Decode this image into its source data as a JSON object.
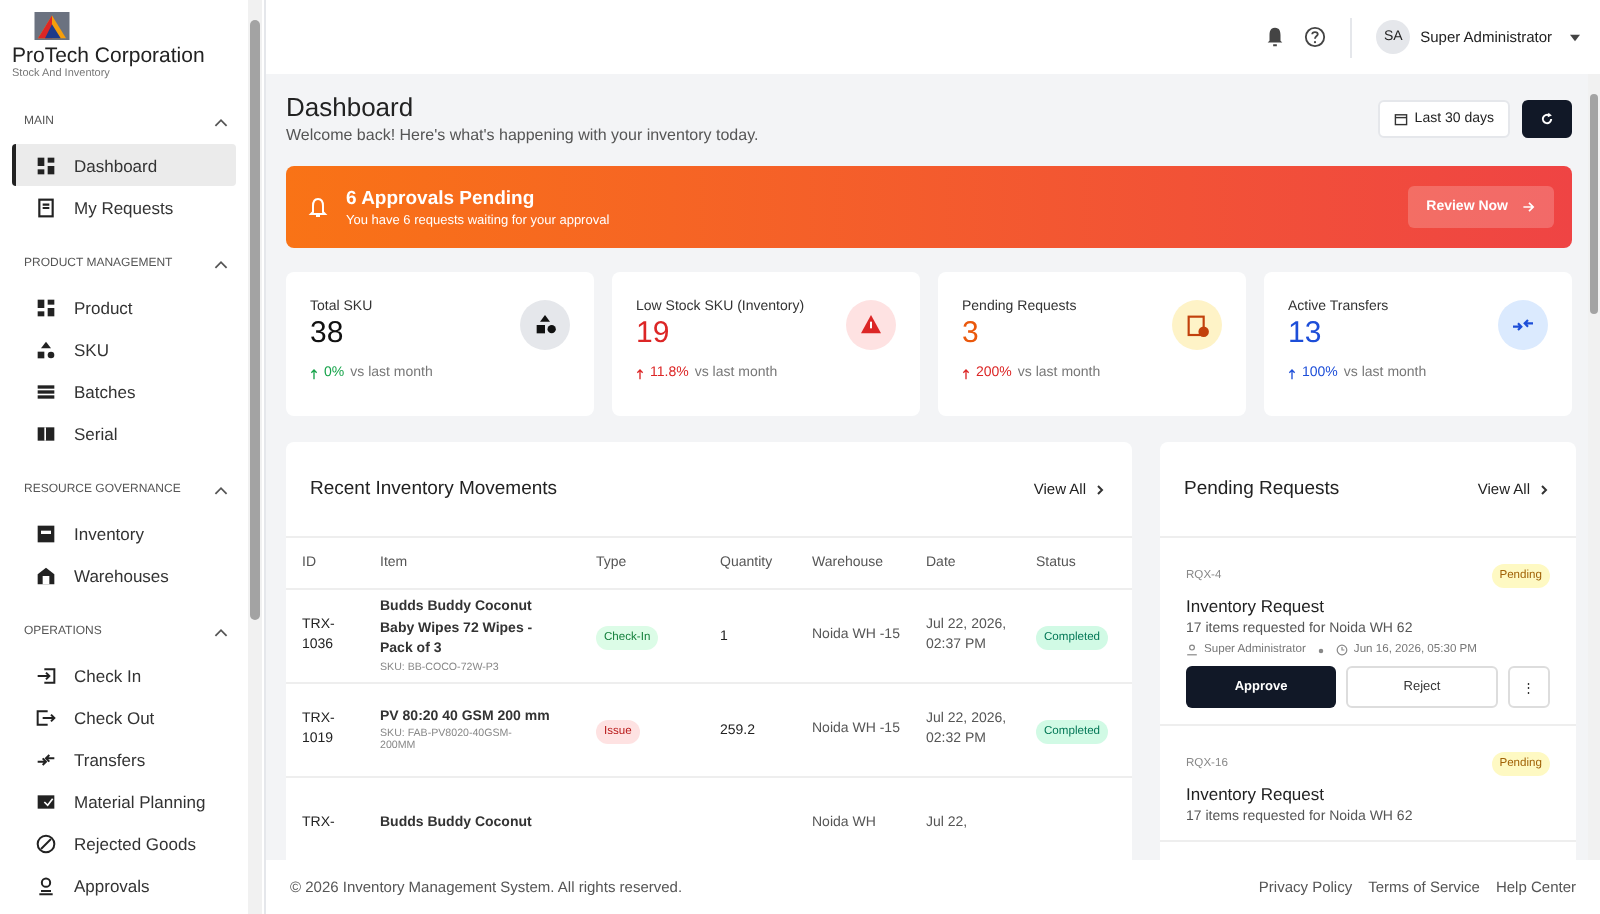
{
  "sidebar": {
    "brand": "ProTech Corporation",
    "subtitle": "Stock And Inventory",
    "sections": [
      {
        "title": "MAIN",
        "expanded": true,
        "items": [
          {
            "label": "Dashboard",
            "selected": true
          },
          {
            "label": "My Requests",
            "selected": false
          }
        ]
      },
      {
        "title": "PRODUCT MANAGEMENT",
        "expanded": true,
        "items": [
          {
            "label": "Product",
            "selected": false
          },
          {
            "label": "SKU",
            "selected": false
          },
          {
            "label": "Batches",
            "selected": false
          },
          {
            "label": "Serial",
            "selected": false
          }
        ]
      },
      {
        "title": "RESOURCE GOVERNANCE",
        "expanded": true,
        "items": [
          {
            "label": "Inventory",
            "selected": false
          },
          {
            "label": "Warehouses",
            "selected": false
          }
        ]
      },
      {
        "title": "OPERATIONS",
        "expanded": true,
        "items": [
          {
            "label": "Check In",
            "selected": false
          },
          {
            "label": "Check Out",
            "selected": false
          },
          {
            "label": "Transfers",
            "selected": false
          },
          {
            "label": "Material Planning",
            "selected": false
          },
          {
            "label": "Rejected Goods",
            "selected": false
          },
          {
            "label": "Approvals",
            "selected": false
          }
        ]
      }
    ]
  },
  "topbar": {
    "avatar": "SA",
    "user": "Super Administrator"
  },
  "header": {
    "title": "Dashboard",
    "subtitle": "Welcome back! Here's what's happening with your inventory today.",
    "range": "Last 30 days"
  },
  "alert": {
    "title": "6 Approvals Pending",
    "message": "You have 6 requests waiting for your approval",
    "button": "Review Now"
  },
  "stats": [
    {
      "label": "Total SKU",
      "value": "38",
      "change": "0%",
      "suffix": "vs last month",
      "kind": "neutral"
    },
    {
      "label": "Low Stock SKU (Inventory)",
      "value": "19",
      "change": "11.8%",
      "suffix": "vs last month",
      "kind": "danger"
    },
    {
      "label": "Pending Requests",
      "value": "3",
      "change": "200%",
      "suffix": "vs last month",
      "kind": "warning"
    },
    {
      "label": "Active Transfers",
      "value": "13",
      "change": "100%",
      "suffix": "vs last month",
      "kind": "info"
    }
  ],
  "movements": {
    "title": "Recent Inventory Movements",
    "view_all": "View All",
    "columns": [
      "ID",
      "Item",
      "Type",
      "Quantity",
      "Warehouse",
      "Date",
      "Status"
    ],
    "rows": [
      {
        "id": "TRX-1036",
        "item": "Budds Buddy Coconut Baby Wipes 72 Wipes - Pack of 3",
        "sku": "SKU: BB-COCO-72W-P3",
        "type": {
          "label": "Check-In",
          "kind": "in"
        },
        "quantity": "1",
        "warehouse": "Noida WH -15",
        "date": "Jul 22, 2026, 02:37 PM",
        "status": "Completed"
      },
      {
        "id": "TRX-1019",
        "item": "PV 80:20 40 GSM 200 mm",
        "sku": "SKU: FAB-PV8020-40GSM-200MM",
        "type": {
          "label": "Issue",
          "kind": "issue"
        },
        "quantity": "259.2",
        "warehouse": "Noida WH -15",
        "date": "Jul 22, 2026, 02:32 PM",
        "status": "Completed"
      },
      {
        "id": "TRX-",
        "item": "Budds Buddy Coconut",
        "warehouse": "Noida WH",
        "date": "Jul 22,"
      }
    ]
  },
  "pending": {
    "title": "Pending Requests",
    "view_all": "View All",
    "requests": [
      {
        "id": "RQX-4",
        "status": "Pending",
        "title": "Inventory Request",
        "description": "17 items requested for Noida WH 62",
        "user": "Super Administrator",
        "time": "Jun 16, 2026, 05:30 PM",
        "approve": "Approve",
        "reject": "Reject",
        "more": "⋮"
      },
      {
        "id": "RQX-16",
        "status": "Pending",
        "title": "Inventory Request",
        "description": "17 items requested for Noida WH 62"
      }
    ]
  },
  "footer": {
    "copyright": "© 2026 Inventory Management System. All rights reserved.",
    "links": [
      "Privacy Policy",
      "Terms of Service",
      "Help Center"
    ]
  }
}
